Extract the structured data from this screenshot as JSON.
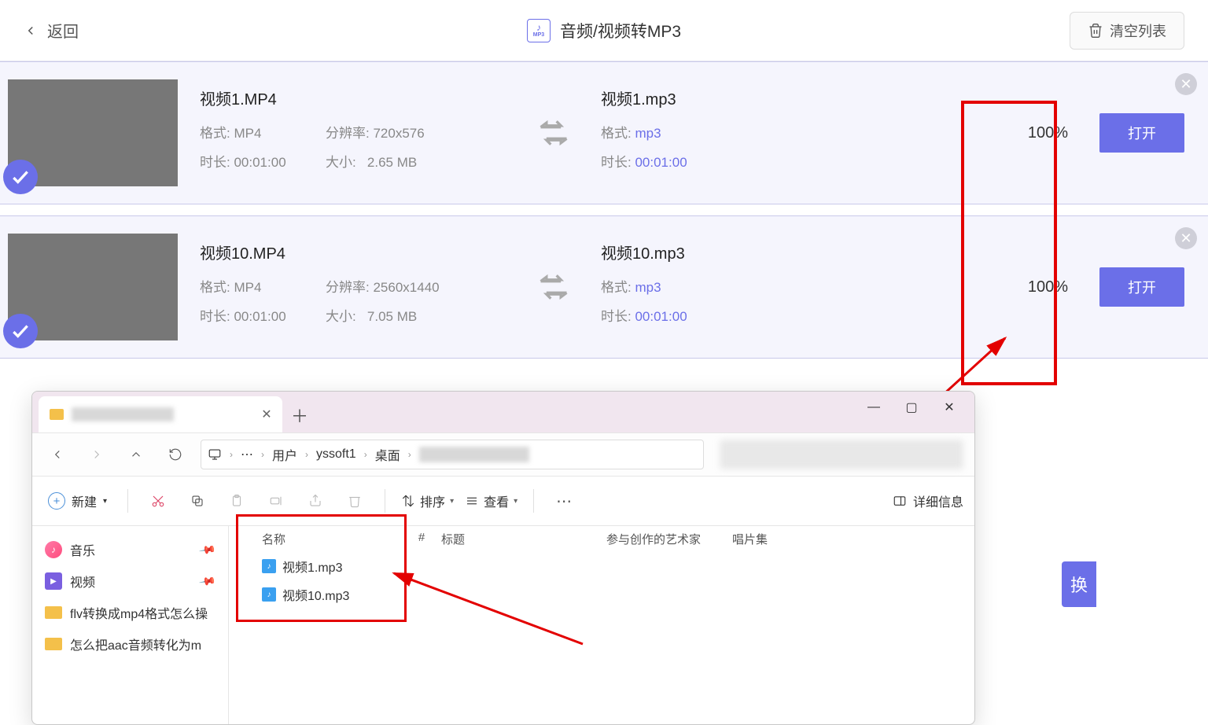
{
  "header": {
    "back": "返回",
    "title": "音频/视频转MP3",
    "clear": "清空列表"
  },
  "labels": {
    "format": "格式:",
    "resolution": "分辨率:",
    "duration": "时长:",
    "size": "大小:",
    "open": "打开"
  },
  "items": [
    {
      "src_name": "视频1.MP4",
      "src_format": "MP4",
      "src_res": "720x576",
      "src_dur": "00:01:00",
      "src_size": "2.65 MB",
      "dst_name": "视频1.mp3",
      "dst_format": "mp3",
      "dst_dur": "00:01:00",
      "progress": "100%"
    },
    {
      "src_name": "视频10.MP4",
      "src_format": "MP4",
      "src_res": "2560x1440",
      "src_dur": "00:01:00",
      "src_size": "7.05 MB",
      "dst_name": "视频10.mp3",
      "dst_format": "mp3",
      "dst_dur": "00:01:00",
      "progress": "100%"
    }
  ],
  "explorer": {
    "breadcrumb": {
      "users": "用户",
      "user": "yssoft1",
      "desktop": "桌面"
    },
    "toolbar": {
      "new": "新建",
      "sort": "排序",
      "view": "查看",
      "details": "详细信息"
    },
    "columns": {
      "name": "名称",
      "num": "#",
      "title": "标题",
      "artist": "参与创作的艺术家",
      "album": "唱片集"
    },
    "sidebar": {
      "music": "音乐",
      "video": "视频",
      "folder1": "flv转换成mp4格式怎么操",
      "folder2": "怎么把aac音频转化为m"
    },
    "files": [
      {
        "name": "视频1.mp3"
      },
      {
        "name": "视频10.mp3"
      }
    ]
  },
  "convert_btn": "换"
}
